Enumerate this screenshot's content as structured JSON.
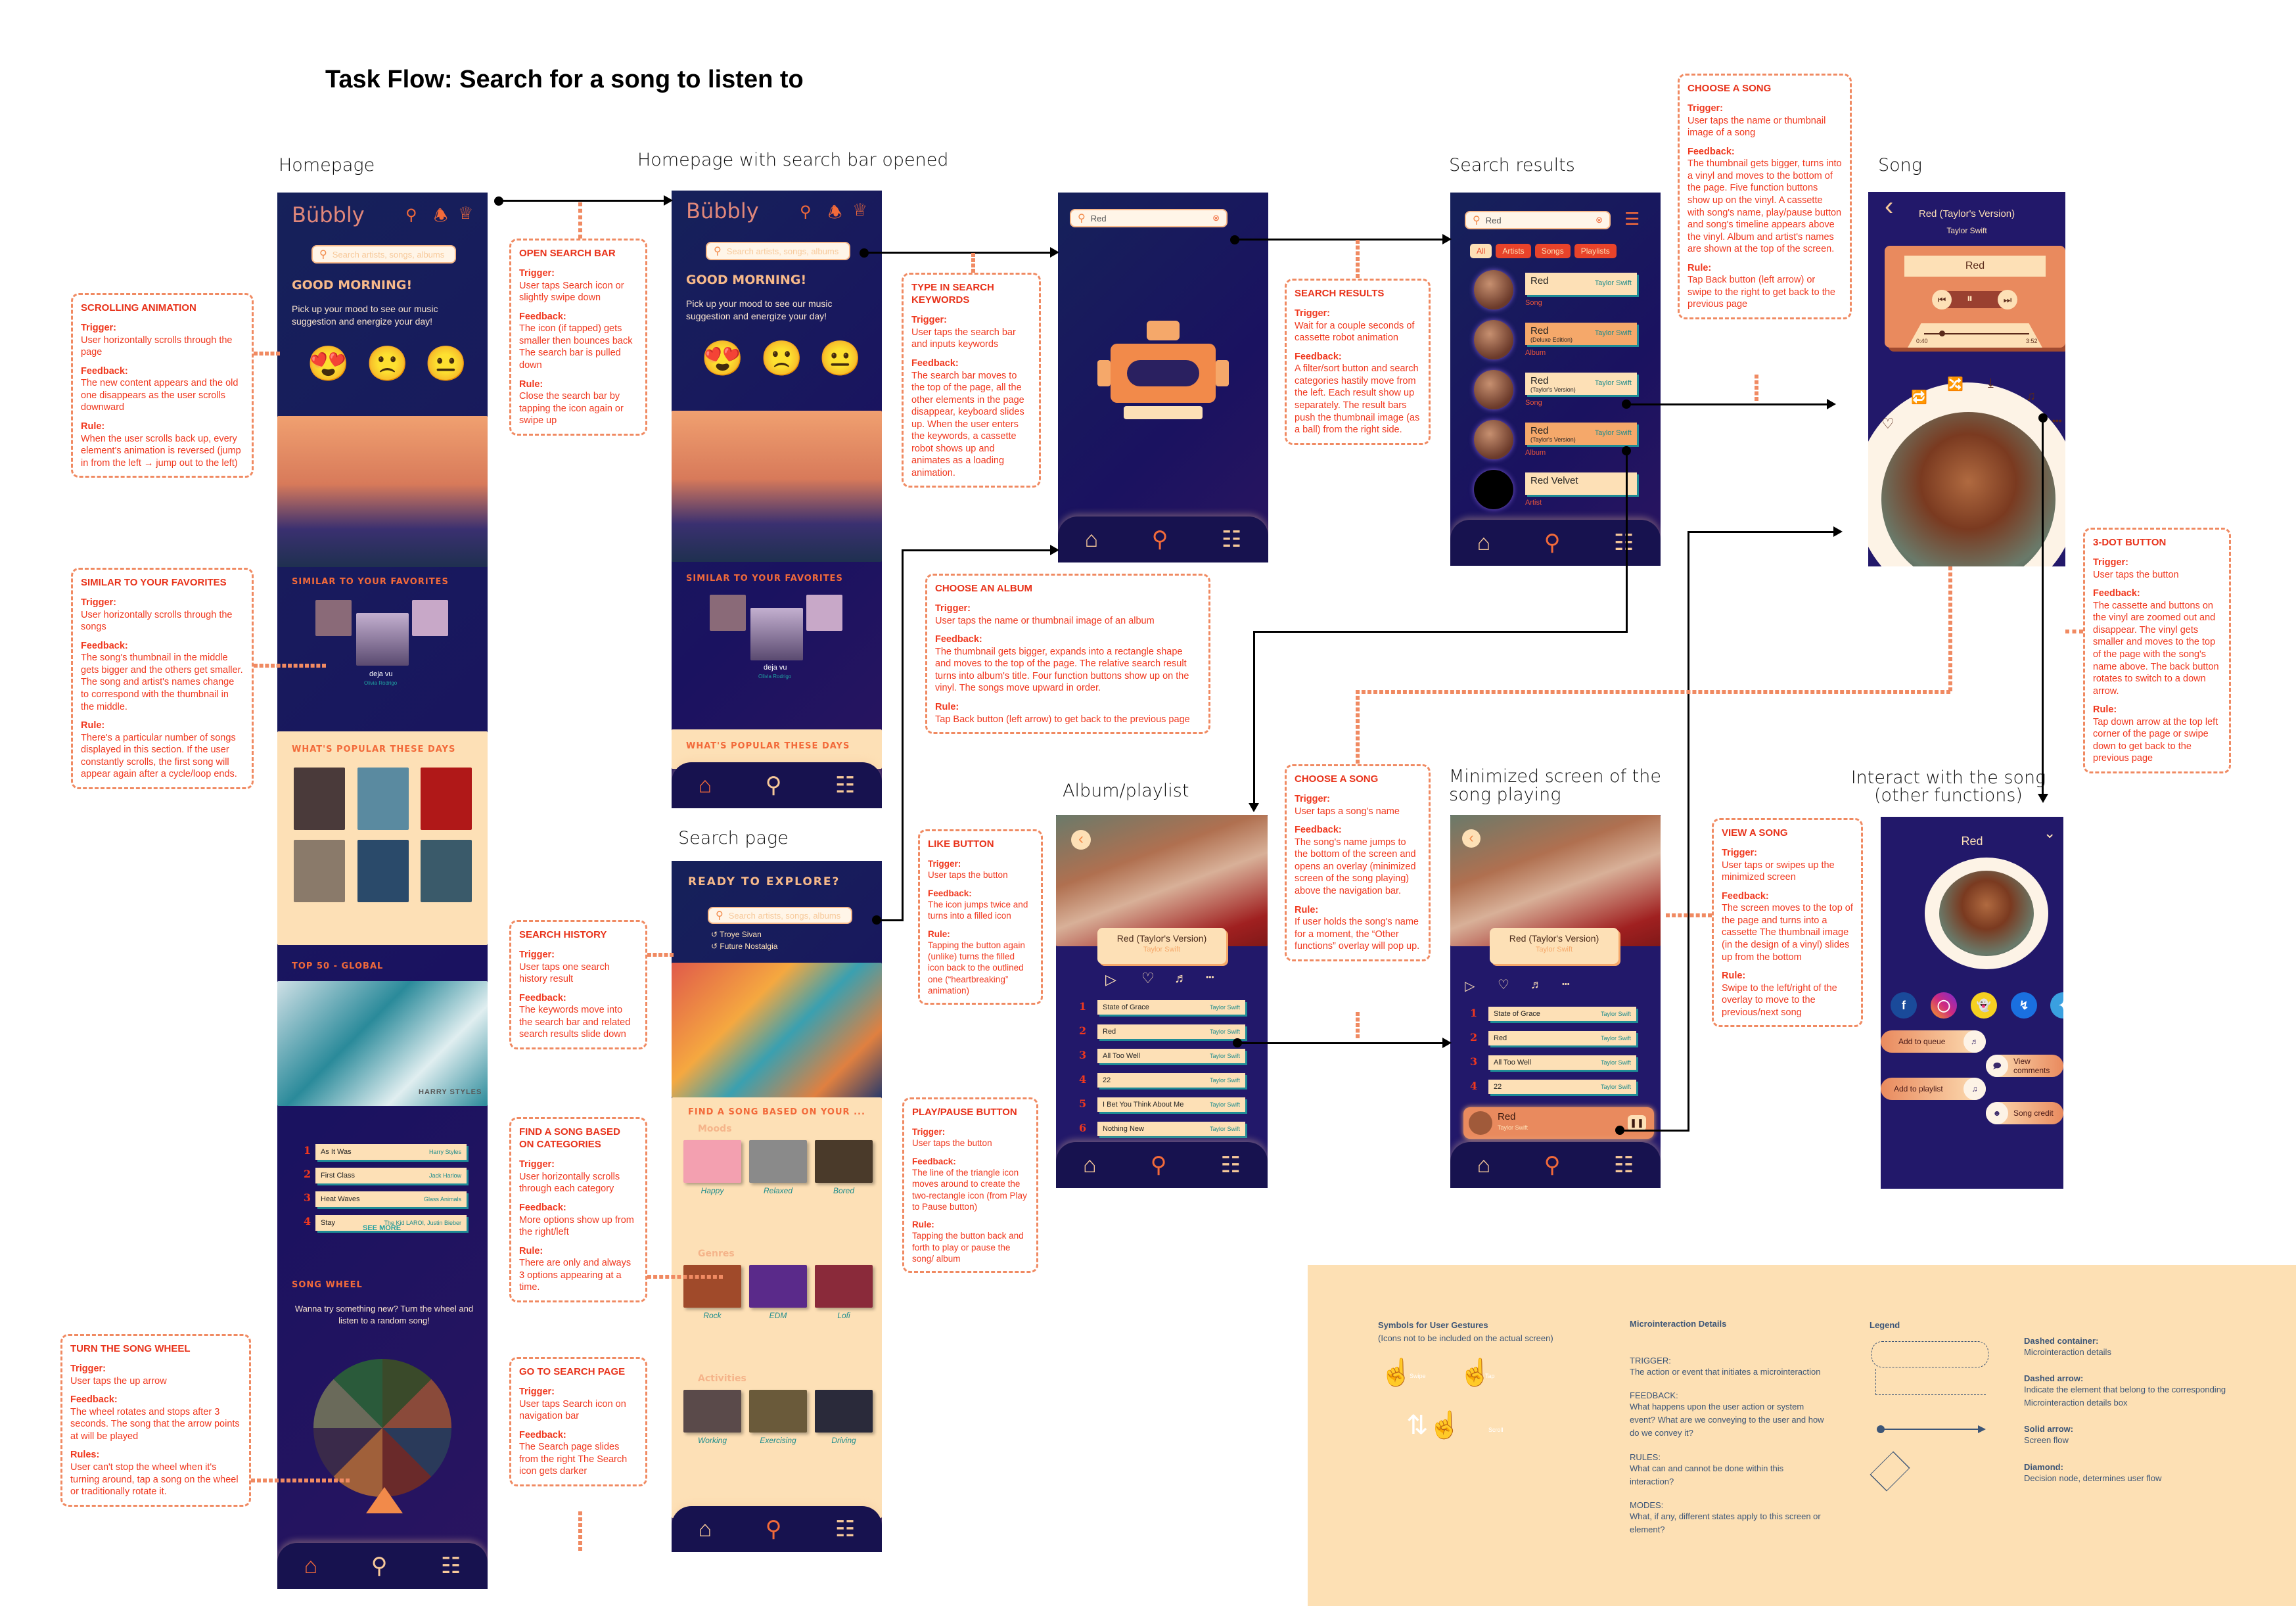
{
  "title": "Task Flow: Search for a song to listen to",
  "screens": {
    "homepage": {
      "label": "Homepage",
      "logo": "Bübbly",
      "search_placeholder": "Search artists, songs, albums",
      "greeting": "GOOD MORNING!",
      "subtitle": "Pick up your mood to see our music suggestion and energize your day!",
      "sections": {
        "similar": "SIMILAR TO YOUR FAVORITES",
        "similar_song": "deja vu",
        "similar_artist": "Olivia Rodrigo",
        "popular": "WHAT'S POPULAR THESE DAYS",
        "top50": "TOP 50 - GLOBAL",
        "top50_banner": "HARRY STYLES",
        "see_more": "SEE MORE",
        "song_wheel": "SONG WHEEL",
        "song_wheel_text": "Wanna try something new? Turn the wheel and listen to a random song!"
      },
      "top50": [
        {
          "rank": "1",
          "song": "As It Was",
          "artist": "Harry Styles"
        },
        {
          "rank": "2",
          "song": "First Class",
          "artist": "Jack Harlow"
        },
        {
          "rank": "3",
          "song": "Heat Waves",
          "artist": "Glass Animals"
        },
        {
          "rank": "4",
          "song": "Stay",
          "artist": "The Kid LAROI, Justin Bieber"
        }
      ]
    },
    "homepage_search": {
      "label": "Homepage with search bar opened",
      "logo": "Bübbly",
      "search_placeholder": "Search artists, songs, albums",
      "greeting": "GOOD MORNING!",
      "subtitle": "Pick up your mood to see our music suggestion and energize your day!",
      "similar": "SIMILAR TO YOUR FAVORITES",
      "similar_song": "deja vu",
      "similar_artist": "Olivia Rodrigo",
      "popular": "WHAT'S POPULAR THESE DAYS"
    },
    "loading": {
      "search_value": "Red"
    },
    "search_page": {
      "label": "Search page",
      "heading": "READY TO EXPLORE?",
      "search_placeholder": "Search artists, songs, albums",
      "history": [
        "Troye Sivan",
        "Future Nostalgia"
      ],
      "find_title": "FIND A SONG BASED ON YOUR ...",
      "groups": [
        {
          "name": "Moods",
          "items": [
            "Happy",
            "Relaxed",
            "Bored"
          ]
        },
        {
          "name": "Genres",
          "items": [
            "Rock",
            "EDM",
            "Lofi"
          ]
        },
        {
          "name": "Activities",
          "items": [
            "Working",
            "Exercising",
            "Driving"
          ]
        }
      ]
    },
    "search_results": {
      "label": "Search results",
      "search_value": "Red",
      "filters": [
        "All",
        "Artists",
        "Songs",
        "Playlists"
      ],
      "results": [
        {
          "title": "Red",
          "sub": "",
          "artist": "Taylor Swift",
          "type": "Song"
        },
        {
          "title": "Red",
          "sub": "(Deluxe Edition)",
          "artist": "Taylor Swift",
          "type": "Album"
        },
        {
          "title": "Red",
          "sub": "(Taylor's Version)",
          "artist": "Taylor Swift",
          "type": "Song"
        },
        {
          "title": "Red",
          "sub": "(Taylor's Version)",
          "artist": "Taylor Swift",
          "type": "Album"
        },
        {
          "title": "Red Velvet",
          "sub": "",
          "artist": "",
          "type": "Artist"
        }
      ]
    },
    "song": {
      "label": "Song",
      "album": "Red (Taylor's Version)",
      "artist": "Taylor Swift",
      "cassette_title": "Red",
      "time_elapsed": "0:40",
      "time_total": "3:52",
      "progress": 0.17
    },
    "album": {
      "label": "Album/playlist",
      "title": "Red (Taylor's Version)",
      "artist": "Taylor Swift",
      "tracks": [
        {
          "n": "1",
          "song": "State of Grace",
          "artist": "Taylor Swift"
        },
        {
          "n": "2",
          "song": "Red",
          "artist": "Taylor Swift"
        },
        {
          "n": "3",
          "song": "All Too Well",
          "artist": "Taylor Swift"
        },
        {
          "n": "4",
          "song": "22",
          "artist": "Taylor Swift"
        },
        {
          "n": "5",
          "song": "I Bet You Think About Me",
          "artist": "Taylor Swift"
        },
        {
          "n": "6",
          "song": "Nothing New",
          "artist": "Taylor Swift"
        }
      ]
    },
    "minimized": {
      "label": "Minimized screen of the song playing",
      "title": "Red (Taylor's Version)",
      "artist": "Taylor Swift",
      "tracks": [
        {
          "n": "1",
          "song": "State of Grace",
          "artist": "Taylor Swift"
        },
        {
          "n": "2",
          "song": "Red",
          "artist": "Taylor Swift"
        },
        {
          "n": "3",
          "song": "All Too Well",
          "artist": "Taylor Swift"
        },
        {
          "n": "4",
          "song": "22",
          "artist": "Taylor Swift"
        }
      ],
      "now_playing_song": "Red",
      "now_playing_artist": "Taylor Swift"
    },
    "interact": {
      "label": "Interact with the song (other functions)",
      "title": "Red",
      "actions": [
        "Add to queue",
        "View comments",
        "Add to playlist",
        "Song credit"
      ],
      "social": [
        "facebook",
        "instagram",
        "snapchat",
        "messenger",
        "twitter"
      ]
    }
  },
  "notes": {
    "scrolling": {
      "title": "SCROLLING ANIMATION",
      "trigger": "User horizontally scrolls through the page",
      "feedback": "The new content appears and the old one disappears as the user scrolls downward",
      "rule": "When the user scrolls back up, every element's animation is reversed (jump in from the left → jump out to the left)"
    },
    "similar": {
      "title": "SIMILAR TO YOUR FAVORITES",
      "trigger": "User horizontally scrolls through the songs",
      "feedback": "The song's thumbnail in the middle gets bigger and the others get smaller. The song and artist's names change to correspond with the thumbnail in the middle.",
      "rule": "There's a particular number of songs displayed in this section. If the user constantly scrolls, the first song will appear again after a cycle/loop ends."
    },
    "wheel": {
      "title": "TURN THE SONG WHEEL",
      "trigger": "User taps the up arrow",
      "feedback": "The wheel rotates and stops after 3 seconds. The song that the arrow points at will be played",
      "rule": "User can't stop the wheel when it's turning around, tap a song on the wheel or traditionally rotate it."
    },
    "open_search": {
      "title": "OPEN SEARCH BAR",
      "trigger": "User taps Search icon or slightly swipe down",
      "feedback": "The icon (if tapped) gets smaller then bounces back The search bar is pulled down",
      "rule": "Close the search bar by tapping the icon again or swipe up"
    },
    "history": {
      "title": "SEARCH HISTORY",
      "trigger": "User taps one search history result",
      "feedback": "The keywords move into the search bar and related search results slide down",
      "rule": ""
    },
    "categories": {
      "title": "FIND A SONG BASED ON CATEGORIES",
      "trigger": "User horizontally scrolls through each category",
      "feedback": "More options show up from the right/left",
      "rule": "There are only and always 3 options appearing at a time."
    },
    "go_search": {
      "title": "GO TO SEARCH PAGE",
      "trigger": "User taps Search icon on navigation bar",
      "feedback": "The Search page slides from the right The Search icon gets darker",
      "rule": ""
    },
    "type_keywords": {
      "title": "TYPE IN SEARCH KEYWORDS",
      "trigger": "User taps the search bar and inputs keywords",
      "feedback": "The search bar moves to the top of the page, all the other elements in the page disappear, keyboard slides up. When the user enters the keywords, a cassette robot shows up and animates as a loading animation.",
      "rule": ""
    },
    "choose_album": {
      "title": "CHOOSE AN ALBUM",
      "trigger": "User taps the name or thumbnail image of an album",
      "feedback": "The thumbnail gets bigger, expands into a rectangle shape and moves to the top of the page. The relative search result turns into album's title. Four function buttons show up on the vinyl. The songs move upward in order.",
      "rule": "Tap Back button (left arrow) to get back to the previous page"
    },
    "like": {
      "title": "LIKE BUTTON",
      "trigger": "User taps the button",
      "feedback": "The icon jumps twice and turns into a filled icon",
      "rule": "Tapping the button again (unlike) turns the filled icon back to the outlined one (“heartbreaking” animation)"
    },
    "play_pause": {
      "title": "PLAY/PAUSE BUTTON",
      "trigger": "User taps the button",
      "feedback": "The line of the triangle icon moves around to create the two-rectangle icon (from Play to Pause button)",
      "rule": "Tapping the button back and forth to play or pause the song/ album"
    },
    "search_results": {
      "title": "SEARCH RESULTS",
      "trigger": "Wait for a couple seconds of cassette robot animation",
      "feedback": "A filter/sort button and search categories hastily move from the left. Each result show up separately. The result bars push the thumbnail image (as a ball) from the right side.",
      "rule": ""
    },
    "choose_song_list": {
      "title": "CHOOSE A SONG",
      "trigger": "User taps a song's name",
      "feedback": "The song's name jumps to the bottom of the screen and opens an overlay (minimized screen of the song playing) above the navigation bar.",
      "rule": "If user holds the song's name for a moment, the “Other functions” overlay will pop up."
    },
    "choose_song": {
      "title": "CHOOSE A SONG",
      "trigger": "User taps the name or thumbnail image of a song",
      "feedback": "The thumbnail gets bigger, turns into a vinyl and moves to the bottom of the page. Five function buttons show up on the vinyl. A cassette with song's name, play/pause button and song's timeline appears above the vinyl. Album and artist's names are shown at the top of the screen.",
      "rule": "Tap Back button (left arrow) or swipe to the right to get back to the previous page"
    },
    "view_song": {
      "title": "VIEW A SONG",
      "trigger": "User taps or swipes up the minimized screen",
      "feedback": "The screen moves to the top of the page and turns into a cassette The thumbnail image (in the design of a vinyl) slides up from the bottom",
      "rule": "Swipe to the left/right of the overlay to move to the previous/next song"
    },
    "three_dot": {
      "title": "3-DOT BUTTON",
      "trigger": "User taps the button",
      "feedback": "The cassette and buttons on the vinyl are zoomed out and disappear. The vinyl gets smaller and moves to the top of the page with the song's name above. The back button rotates to switch to a down arrow.",
      "rule": "Tap down arrow at the top left corner of the page or swipe down to get back to the previous page"
    }
  },
  "labels": {
    "trigger": "Trigger:",
    "feedback": "Feedback:",
    "rule": "Rule:",
    "rules": "Rules:"
  },
  "legend": {
    "gestures_title": "Symbols for User Gestures",
    "gestures_sub": "(Icons not to be included on the actual screen)",
    "gestures": [
      "Swipe",
      "Tap",
      "Scroll"
    ],
    "micro_title": "Microinteraction Details",
    "micro": [
      {
        "k": "TRIGGER:",
        "v": "The action or event that initiates a microinteraction"
      },
      {
        "k": "FEEDBACK:",
        "v": "What happens upon the user action or system event? What are we conveying to the user and how do we convey it?"
      },
      {
        "k": "RULES:",
        "v": "What can and cannot be done within this interaction?"
      },
      {
        "k": "MODES:",
        "v": "What, if any, different states apply to this screen or element?"
      }
    ],
    "legend_title": "Legend",
    "items": [
      {
        "k": "Dashed container:",
        "v": "Microinteraction details"
      },
      {
        "k": "Dashed arrow:",
        "v": "Indicate the element that belong to the corresponding Microinteraction details box"
      },
      {
        "k": "Solid arrow:",
        "v": "Screen flow"
      },
      {
        "k": "Diamond:",
        "v": "Decision node, determines user flow"
      }
    ]
  },
  "colors": {
    "accent": "#f26a3a",
    "note": "#f0381e",
    "phone_bg": "#1a1260",
    "cream": "#fde0b6",
    "teal": "#1d8c8c"
  }
}
